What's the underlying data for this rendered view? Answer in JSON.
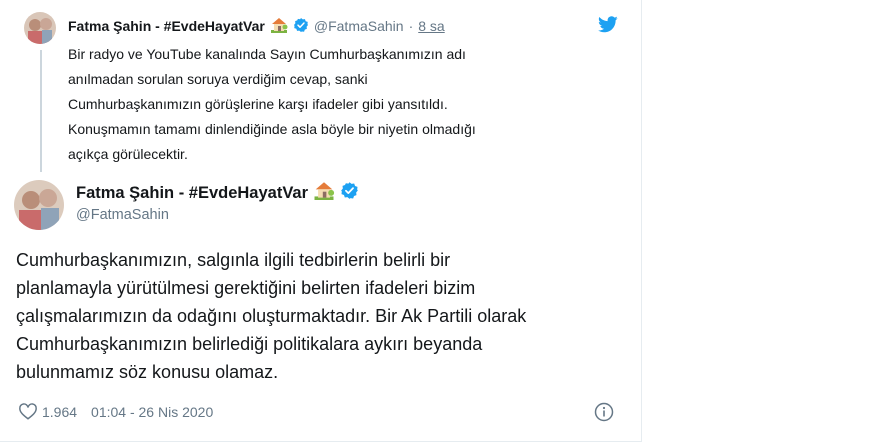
{
  "quoted_tweet": {
    "display_name": "Fatma Şahin - #EvdeHayatVar",
    "handle": "@FatmaSahin",
    "separator": "·",
    "time": "8 sa",
    "text_lines": [
      "Bir radyo ve YouTube kanalında Sayın Cumhurbaşkanımızın adı",
      "anılmadan sorulan soruya verdiğim cevap, sanki",
      "Cumhurbaşkanımızın görüşlerine karşı ifadeler gibi yansıtıldı.",
      "Konuşmamın tamamı dinlendiğinde asla böyle bir niyetin olmadığı",
      "açıkça görülecektir."
    ]
  },
  "main_tweet": {
    "display_name": "Fatma Şahin - #EvdeHayatVar",
    "handle": "@FatmaSahin",
    "text_lines": [
      "Cumhurbaşkanımızın, salgınla ilgili tedbirlerin belirli bir",
      "planlamayla yürütülmesi gerektiğini belirten ifadeleri bizim",
      "çalışmalarımızın da odağını oluşturmaktadır. Bir Ak Partili olarak",
      "Cumhurbaşkanımızın belirlediği politikalara aykırı beyanda",
      "bulunmamız söz konusu olamaz."
    ],
    "like_count": "1.964",
    "timestamp": "01:04 - 26 Nis 2020"
  },
  "icons": {
    "verified": "verified-badge-icon",
    "house": "house-with-garden-emoji-icon",
    "twitter": "twitter-bird-icon",
    "like": "heart-icon",
    "info": "info-icon"
  },
  "colors": {
    "twitter_blue": "#1da1f2",
    "text_primary": "#14171a",
    "text_secondary": "#657786",
    "thread_line": "#ccd6dd"
  }
}
